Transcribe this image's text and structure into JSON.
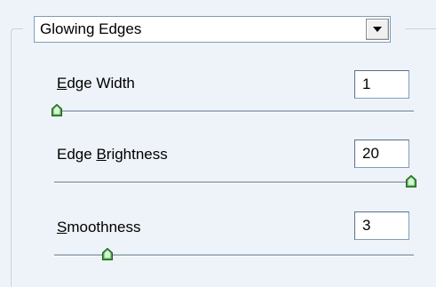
{
  "filter": {
    "selected": "Glowing Edges"
  },
  "controls": [
    {
      "label_pre": "",
      "label_access": "E",
      "label_post": "dge Width",
      "value": "1",
      "min": 1,
      "max": 14,
      "level": 0.0
    },
    {
      "label_pre": "Edge ",
      "label_access": "B",
      "label_post": "rightness",
      "value": "20",
      "min": 0,
      "max": 20,
      "level": 1.0
    },
    {
      "label_pre": "",
      "label_access": "S",
      "label_post": "moothness",
      "value": "3",
      "min": 1,
      "max": 15,
      "level": 0.143
    }
  ],
  "colors": {
    "background": "#eef3fa",
    "thumb_fill": "#3fa33f",
    "track": "#a7b4c1"
  },
  "icons": {
    "dropdown": "chevron-down-icon",
    "slider": "slider-thumb-icon"
  }
}
